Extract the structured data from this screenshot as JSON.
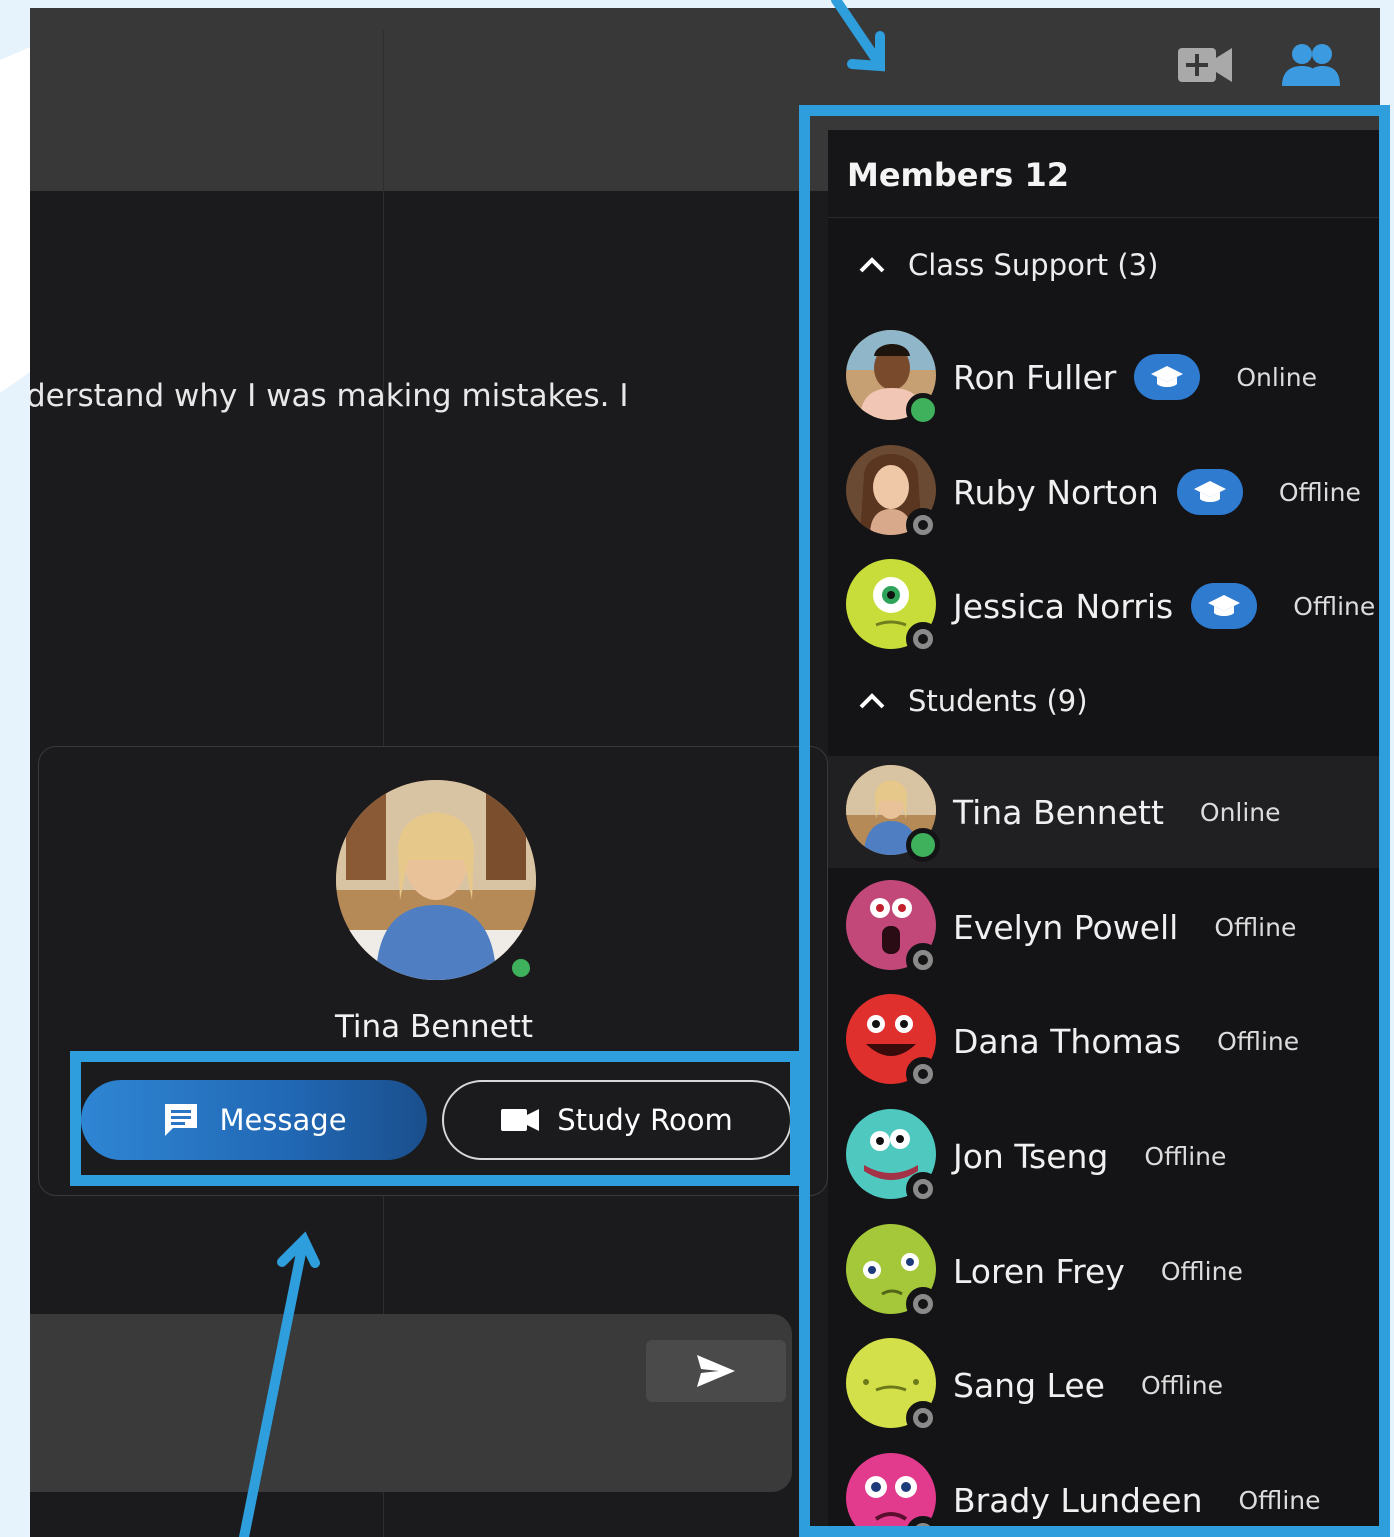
{
  "colors": {
    "accent": "#2e9fdc",
    "app_bg": "#1b1b1d",
    "panel_bg": "#141416",
    "online": "#3fb05b",
    "badge": "#2f7bd0",
    "light_bg": "#e6f3fc"
  },
  "topbar": {
    "video_icon": "video-plus-icon",
    "members_icon": "people-icon"
  },
  "chat": {
    "message_fragment": "derstand why I was making mistakes. I"
  },
  "profile_card": {
    "name": "Tina Bennett",
    "status": "online",
    "message_button": "Message",
    "study_room_button": "Study Room"
  },
  "members_panel": {
    "title": "Members 12",
    "groups": [
      {
        "label": "Class Support (3)",
        "members": [
          {
            "name": "Ron Fuller",
            "status": "Online",
            "teacher_badge": true
          },
          {
            "name": "Ruby Norton",
            "status": "Offline",
            "teacher_badge": true
          },
          {
            "name": "Jessica Norris",
            "status": "Offline",
            "teacher_badge": true
          }
        ]
      },
      {
        "label": "Students (9)",
        "members": [
          {
            "name": "Tina Bennett",
            "status": "Online",
            "teacher_badge": false
          },
          {
            "name": "Evelyn Powell",
            "status": "Offline",
            "teacher_badge": false
          },
          {
            "name": "Dana Thomas",
            "status": "Offline",
            "teacher_badge": false
          },
          {
            "name": "Jon Tseng",
            "status": "Offline",
            "teacher_badge": false
          },
          {
            "name": "Loren Frey",
            "status": "Offline",
            "teacher_badge": false
          },
          {
            "name": "Sang Lee",
            "status": "Offline",
            "teacher_badge": false
          },
          {
            "name": "Brady Lundeen",
            "status": "Offline",
            "teacher_badge": false
          }
        ]
      }
    ]
  }
}
